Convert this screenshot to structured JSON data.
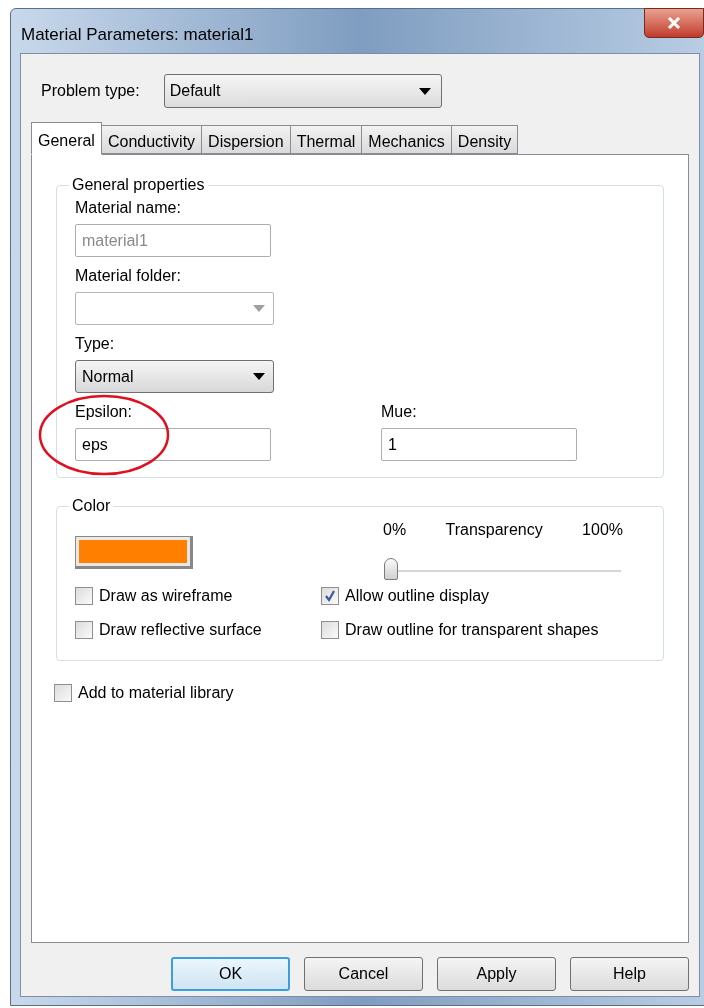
{
  "window": {
    "title": "Material Parameters: material1"
  },
  "problem_type": {
    "label": "Problem type:",
    "value": "Default"
  },
  "tabs": [
    {
      "label": "General",
      "selected": true
    },
    {
      "label": "Conductivity",
      "selected": false
    },
    {
      "label": "Dispersion",
      "selected": false
    },
    {
      "label": "Thermal",
      "selected": false
    },
    {
      "label": "Mechanics",
      "selected": false
    },
    {
      "label": "Density",
      "selected": false
    }
  ],
  "general": {
    "title": "General properties",
    "material_name": {
      "label": "Material name:",
      "value": "material1",
      "disabled": true
    },
    "material_folder": {
      "label": "Material folder:",
      "disabled": true
    },
    "type": {
      "label": "Type:",
      "value": "Normal"
    },
    "epsilon": {
      "label": "Epsilon:",
      "value": "eps",
      "circled": true
    },
    "mue": {
      "label": "Mue:",
      "value": "1"
    }
  },
  "color_group": {
    "title": "Color",
    "swatch": {
      "color": "#ff8000"
    },
    "transparency": {
      "min": "0%",
      "label": "Transparency",
      "max": "100%",
      "level": 0
    },
    "checkboxes": [
      {
        "label": "Draw as wireframe",
        "checked": false
      },
      {
        "label": "Allow outline display",
        "checked": true
      },
      {
        "label": "Draw reflective surface",
        "checked": false
      },
      {
        "label": "Draw outline for transparent shapes",
        "checked": false
      }
    ]
  },
  "add_to_library": {
    "label": "Add to material library",
    "checked": false
  },
  "buttons": [
    {
      "label": "OK",
      "default": true
    },
    {
      "label": "Cancel",
      "default": false
    },
    {
      "label": "Apply",
      "default": false
    },
    {
      "label": "Help",
      "default": false
    }
  ]
}
